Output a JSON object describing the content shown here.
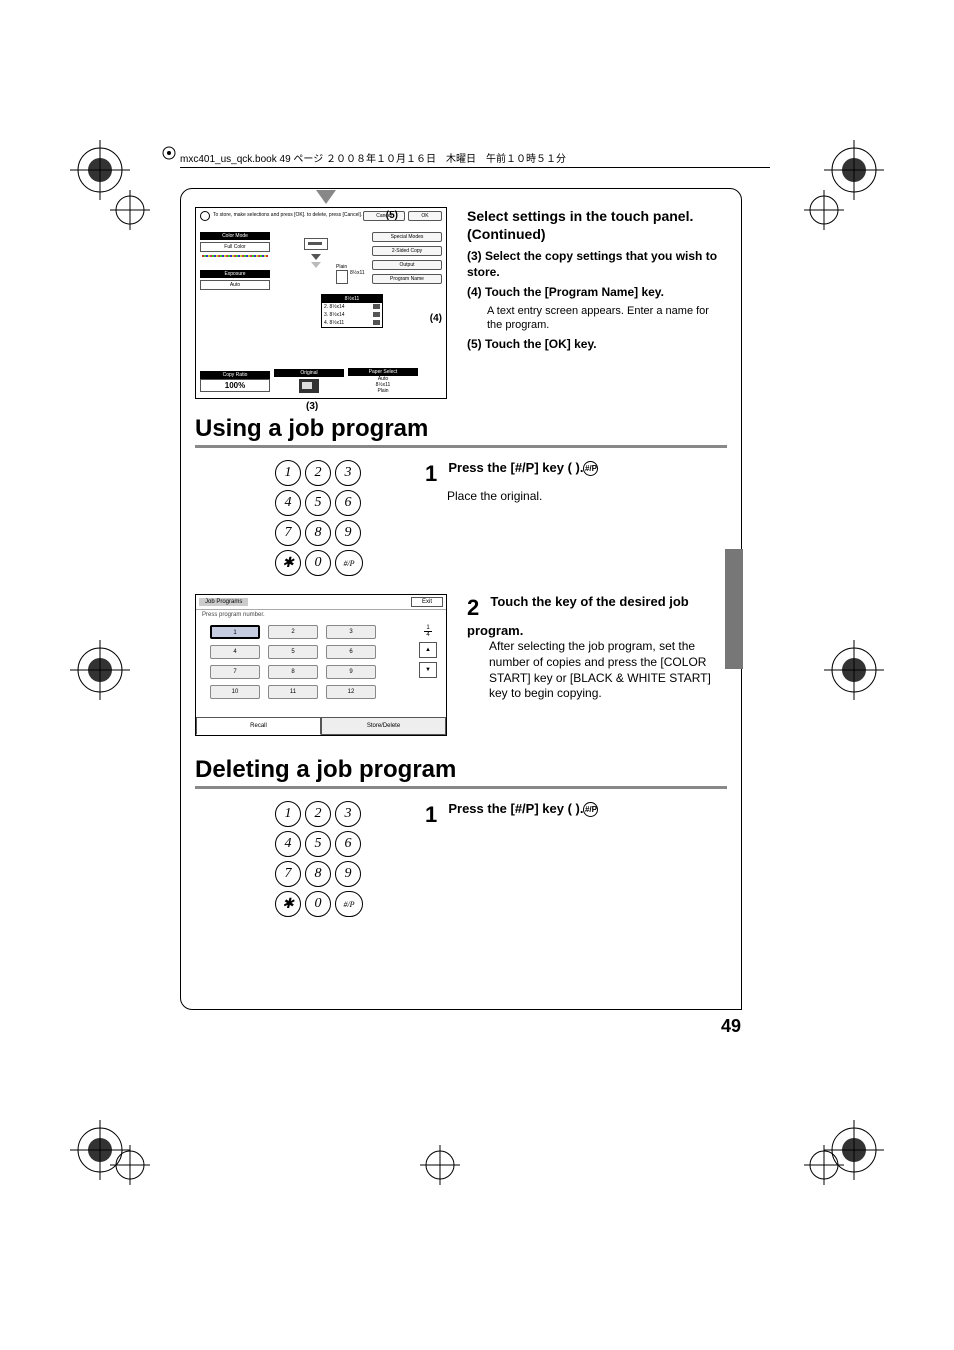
{
  "header_text": "mxc401_us_qck.book  49 ページ  ２００８年１０月１６日　木曜日　午前１０時５１分",
  "page_number": "49",
  "panel": {
    "instruction": "To store, make selections and press [OK]. to delete, press [Cancel].",
    "cancel": "Cancel",
    "ok": "OK",
    "color_mode_lbl": "Color Mode",
    "color_mode_val": "Full Color",
    "exposure_lbl": "Exposure",
    "exposure_val": "Auto",
    "special_modes": "Special Modes",
    "two_sided": "2-Sided Copy",
    "output": "Output",
    "program_name": "Program Name",
    "paper_plain": "Plain",
    "paper_size": "8½x11",
    "prog_hdr": "8½x11",
    "prog1": "2. 8½x14",
    "prog2": "3. 8½x14",
    "prog3": "4. 8½x11",
    "copy_ratio_lbl": "Copy Ratio",
    "copy_ratio_val": "100%",
    "original_lbl": "Original",
    "paper_select_lbl": "Paper Select",
    "paper_select_v1": "Auto",
    "paper_select_v2": "8½x11",
    "paper_select_v3": "Plain",
    "callout3": "(3)",
    "callout4": "(4)",
    "callout5": "(5)"
  },
  "top_text": {
    "heading": "Select settings in the touch panel. (Continued)",
    "i3": "(3) Select the copy settings that you wish to store.",
    "i4": "(4) Touch the [Program Name] key.",
    "i4s": "A text entry screen appears. Enter a name for the program.",
    "i5": "(5) Touch the [OK] key."
  },
  "h_using": "Using a job program",
  "keypad": [
    "1",
    "2",
    "3",
    "4",
    "5",
    "6",
    "7",
    "8",
    "9",
    "✱",
    "0",
    "#/P"
  ],
  "using_step1": {
    "num": "1",
    "head": "Press the [#/P] key (    ).",
    "body": "Place the original."
  },
  "jp_panel": {
    "title": "Job Programs",
    "exit": "Exit",
    "msg": "Press program number.",
    "btns": [
      "1",
      "2",
      "3",
      "4",
      "5",
      "6",
      "7",
      "8",
      "9",
      "10",
      "11",
      "12"
    ],
    "frac_top": "1",
    "frac_bot": "4",
    "tab_recall": "Recall",
    "tab_store": "Store/Delete"
  },
  "using_step2": {
    "num": "2",
    "head": "Touch the key of the desired job program.",
    "body": "After selecting the job program, set the number of copies and press the [COLOR START] key or [BLACK & WHITE START] key to begin copying."
  },
  "h_deleting": "Deleting a job program",
  "deleting_step1": {
    "num": "1",
    "head": "Press the [#/P] key (    )."
  }
}
